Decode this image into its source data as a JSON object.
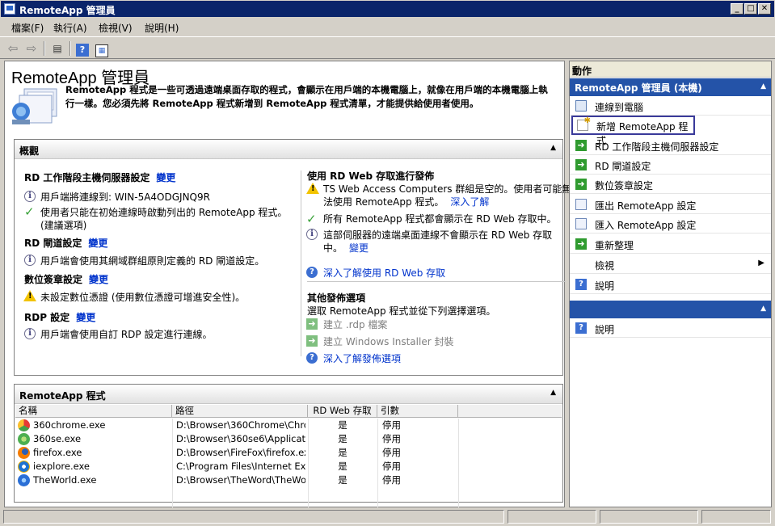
{
  "window": {
    "title": "RemoteApp 管理員"
  },
  "menu": [
    "檔案(F)",
    "執行(A)",
    "檢視(V)",
    "說明(H)"
  ],
  "main": {
    "title": "RemoteApp 管理員",
    "intro": "RemoteApp 程式是一些可透過遠端桌面存取的程式，會顯示在用戶端的本機電腦上，就像在用戶端的本機電腦上執行一樣。您必須先將 RemoteApp 程式新增到 RemoteApp 程式清單，才能提供給使用者使用。",
    "overview": {
      "header": "概觀",
      "rdsh": {
        "title": "RD 工作階段主機伺服器設定",
        "change": "變更",
        "line1": "用戶端將連線到: WIN-5A4ODGJNQ9R",
        "line2a": "使用者只能在初始連線時啟動列出的 RemoteApp 程式。",
        "line2b": "(建議選項)"
      },
      "gateway": {
        "title": "RD 閘道設定",
        "change": "變更",
        "line1": "用戶端會使用其網域群組原則定義的 RD 閘道設定。"
      },
      "cert": {
        "title": "數位簽章設定",
        "change": "變更",
        "line1": "未設定數位憑證 (使用數位憑證可增進安全性)。"
      },
      "rdp": {
        "title": "RDP 設定",
        "change": "變更",
        "line1": "用戶端會使用自訂 RDP 設定進行連線。"
      },
      "web": {
        "title": "使用 RD Web 存取進行發佈",
        "warn_a": "TS Web Access Computers 群組是空的。使用者可能無",
        "warn_b": "法使用 RemoteApp 程式。",
        "warn_link": "深入了解",
        "ok": "所有 RemoteApp 程式都會顯示在 RD Web 存取中。",
        "info_a": "這部伺服器的遠端桌面連線不會顯示在 RD Web 存取",
        "info_b": "中。",
        "info_link": "變更",
        "help": "深入了解使用 RD Web 存取"
      },
      "other": {
        "title": "其他發佈選項",
        "desc": "選取 RemoteApp 程式並從下列選擇選項。",
        "rdp_file": "建立 .rdp 檔案",
        "msi": "建立 Windows Installer 封裝",
        "help": "深入了解發佈選項"
      }
    },
    "programs": {
      "header": "RemoteApp 程式",
      "columns": [
        "名稱",
        "路徑",
        "RD Web 存取",
        "引數"
      ],
      "rows": [
        {
          "name": "360chrome.exe",
          "path": "D:\\Browser\\360Chrome\\Chro...",
          "web": "是",
          "args": "停用",
          "icon_color": "#3cb44b"
        },
        {
          "name": "360se.exe",
          "path": "D:\\Browser\\360se6\\Applicati...",
          "web": "是",
          "args": "停用",
          "icon_color": "#5cc23a"
        },
        {
          "name": "firefox.exe",
          "path": "D:\\Browser\\FireFox\\firefox.exe",
          "web": "是",
          "args": "停用",
          "icon_color": "#e66000"
        },
        {
          "name": "iexplore.exe",
          "path": "C:\\Program Files\\Internet Ex...",
          "web": "是",
          "args": "停用",
          "icon_color": "#1e73d2"
        },
        {
          "name": "TheWorld.exe",
          "path": "D:\\Browser\\TheWord\\TheWo...",
          "web": "是",
          "args": "停用",
          "icon_color": "#2a6fd6"
        }
      ]
    }
  },
  "actions": {
    "header": "動作",
    "section1": "RemoteApp 管理員 (本機)",
    "items": [
      {
        "label": "連線到電腦",
        "icon": "computer-icon"
      },
      {
        "label": "新增 RemoteApp 程式",
        "icon": "new-program-icon"
      },
      {
        "label": "RD 工作階段主機伺服器設定",
        "icon": "green-arrow-icon"
      },
      {
        "label": "RD 閘道設定",
        "icon": "green-arrow-icon"
      },
      {
        "label": "數位簽章設定",
        "icon": "green-arrow-icon"
      },
      {
        "label": "匯出 RemoteApp 設定",
        "icon": "export-icon"
      },
      {
        "label": "匯入 RemoteApp 設定",
        "icon": "import-icon"
      },
      {
        "label": "重新整理",
        "icon": "refresh-icon"
      },
      {
        "label": "檢視",
        "icon": ""
      },
      {
        "label": "說明",
        "icon": "help-icon"
      }
    ],
    "section2_help": "說明"
  }
}
